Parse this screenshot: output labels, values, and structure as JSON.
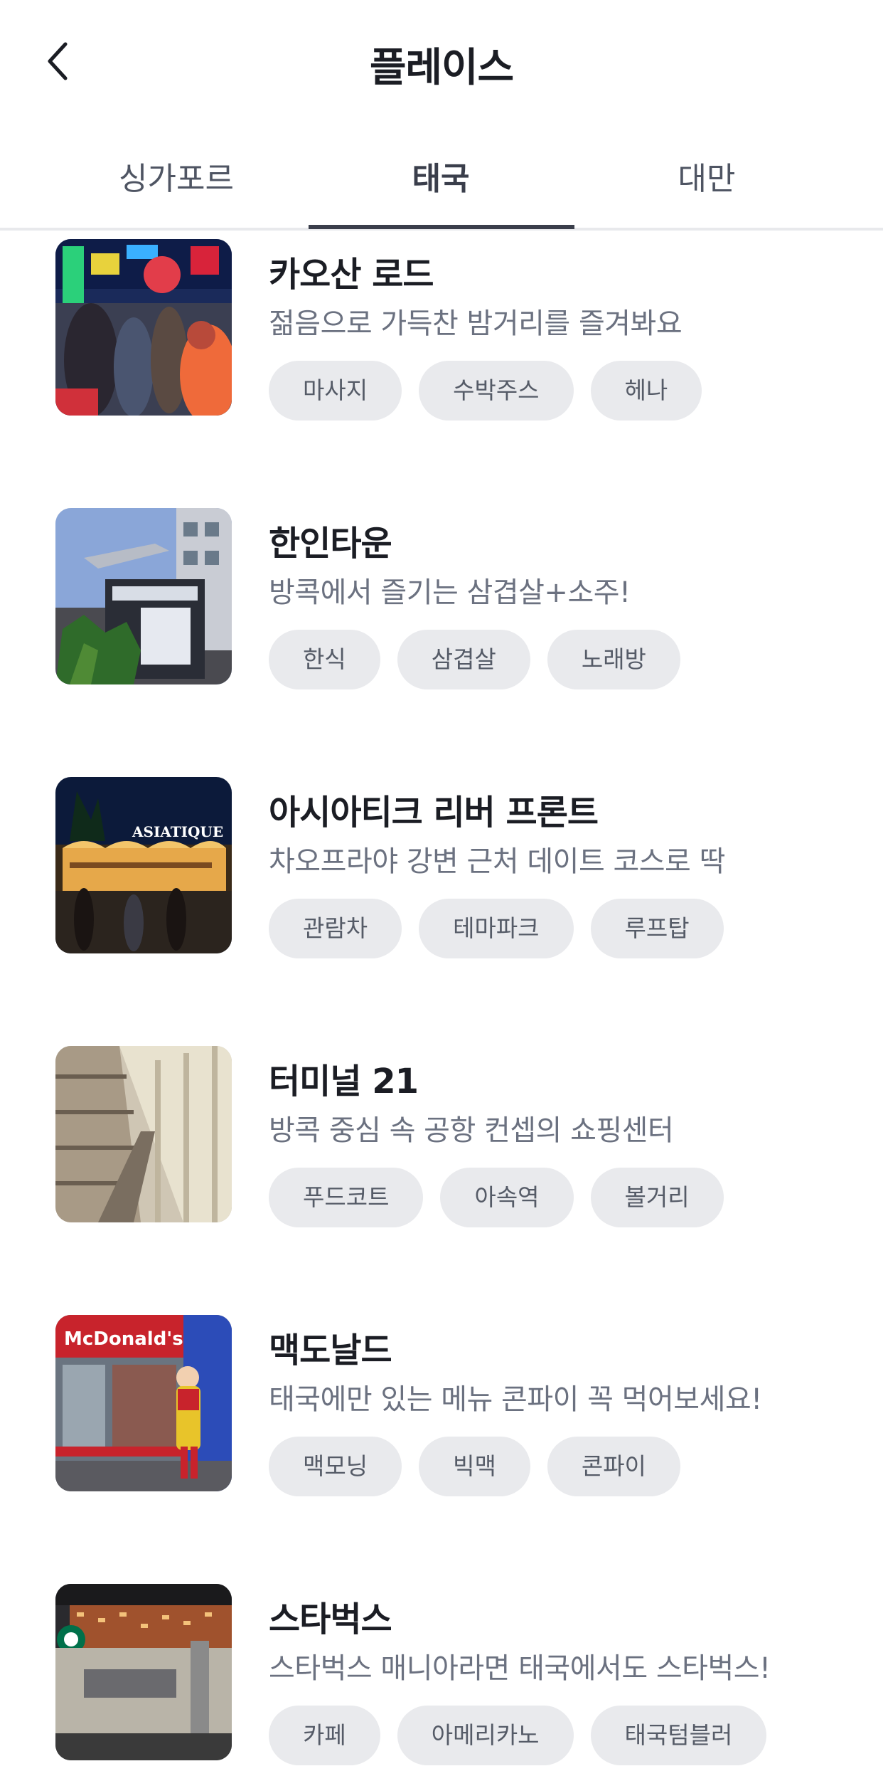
{
  "header": {
    "title": "플레이스"
  },
  "tabs": [
    {
      "label": "싱가포르",
      "active": false
    },
    {
      "label": "태국",
      "active": true
    },
    {
      "label": "대만",
      "active": false
    }
  ],
  "places": [
    {
      "name": "카오산 로드",
      "desc": "젊음으로 가득찬 밤거리를 즐겨봐요",
      "tags": [
        "마사지",
        "수박주스",
        "헤나"
      ],
      "image": "night-street-photo"
    },
    {
      "name": "한인타운",
      "desc": "방콕에서 즐기는 삼겹살+소주!",
      "tags": [
        "한식",
        "삼겹살",
        "노래방"
      ],
      "image": "korea-town-sign-photo"
    },
    {
      "name": "아시아티크 리버 프론트",
      "desc": "차오프라야 강변 근처 데이트 코스로 딱",
      "tags": [
        "관람차",
        "테마파크",
        "루프탑"
      ],
      "image": "asiatique-night-photo",
      "image_text": "ASIATIQUE"
    },
    {
      "name": "터미널 21",
      "desc": "방콕 중심 속 공항 컨셉의 쇼핑센터",
      "tags": [
        "푸드코트",
        "아속역",
        "볼거리"
      ],
      "image": "mall-atrium-photo"
    },
    {
      "name": "맥도날드",
      "desc": "태국에만 있는 메뉴 콘파이 꼭 먹어보세요!",
      "tags": [
        "맥모닝",
        "빅맥",
        "콘파이"
      ],
      "image": "mcdonalds-storefront-photo",
      "image_text": "McDonald's"
    },
    {
      "name": "스타벅스",
      "desc": "스타벅스 매니아라면 태국에서도 스타벅스!",
      "tags": [
        "카페",
        "아메리카노",
        "태국텀블러"
      ],
      "image": "starbucks-store-photo"
    }
  ]
}
